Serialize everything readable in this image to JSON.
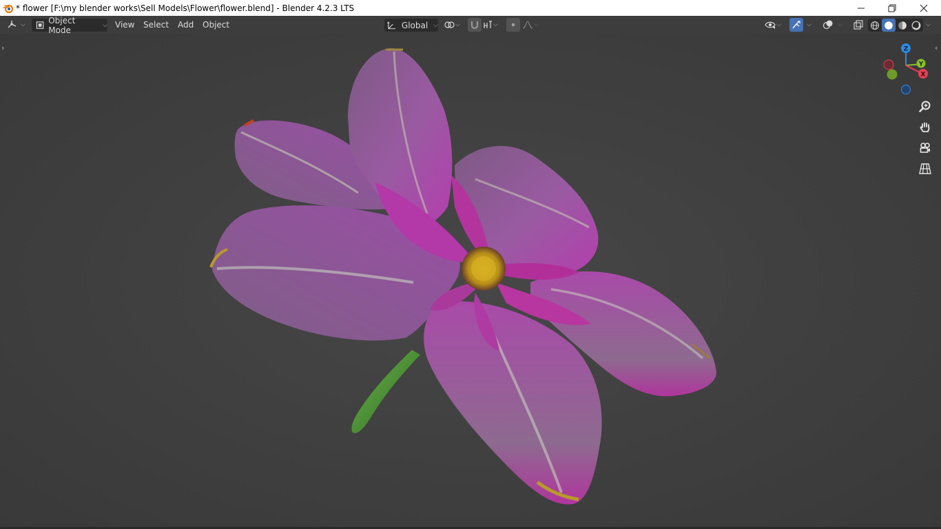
{
  "window": {
    "title": "* flower [F:\\my blender works\\Sell Models\\Flower\\flower.blend] - Blender 4.2.3 LTS",
    "controls": [
      "minimize-icon",
      "restore-icon",
      "close-icon"
    ]
  },
  "header": {
    "editor_type_icon": "3d-viewport-icon",
    "mode": {
      "label": "Object Mode",
      "icon": "object-mode-icon"
    },
    "menus": [
      "View",
      "Select",
      "Add",
      "Object"
    ],
    "transform_orientation": {
      "label": "Global",
      "icon": "orientation-icon"
    },
    "pivot_icon": "pivot-point-icon",
    "snap_icons": [
      "snap-magnet-icon",
      "snap-target-icon"
    ],
    "proportional_icons": [
      "proportional-edit-icon",
      "falloff-curve-icon"
    ],
    "right_icons": [
      "visibility-icon",
      "gizmo-icon",
      "overlay-icon",
      "xray-icon"
    ],
    "shading_modes": [
      "wireframe",
      "solid",
      "material-preview",
      "rendered"
    ],
    "active_shading": "solid"
  },
  "gizmo": {
    "axes": [
      "Z",
      "Y",
      "X"
    ],
    "colors": {
      "x": "#e84055",
      "y": "#8bbf2b",
      "z": "#2f8ae0"
    }
  },
  "nav_tools": [
    "zoom-icon",
    "pan-hand-icon",
    "camera-view-icon",
    "ortho-grid-icon"
  ],
  "colors": {
    "viewport_bg": "#3d3d3d",
    "petal_base": "#8a5590",
    "petal_magenta": "#b23aa8",
    "petal_vein": "#c8d0c0",
    "center": "#d7b020",
    "stem": "#4d8f35"
  }
}
